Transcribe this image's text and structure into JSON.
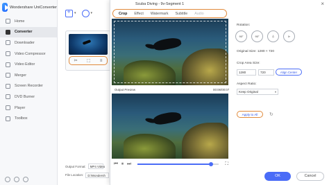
{
  "app": {
    "name": "Wondershare UniConverter"
  },
  "sidebar": {
    "items": [
      {
        "label": "Home",
        "icon": "home-icon"
      },
      {
        "label": "Converter",
        "icon": "converter-icon",
        "active": true
      },
      {
        "label": "Downloader",
        "icon": "download-icon"
      },
      {
        "label": "Video Compressor",
        "icon": "compress-icon"
      },
      {
        "label": "Video Editor",
        "icon": "scissors-icon"
      },
      {
        "label": "Merger",
        "icon": "merge-icon"
      },
      {
        "label": "Screen Recorder",
        "icon": "record-icon"
      },
      {
        "label": "DVD Burner",
        "icon": "disc-icon"
      },
      {
        "label": "Player",
        "icon": "play-icon"
      },
      {
        "label": "Toolbox",
        "icon": "toolbox-icon"
      }
    ]
  },
  "converter": {
    "output_format_label": "Output Format:",
    "output_format_value": "MP4 Video",
    "file_location_label": "File Location:",
    "file_location_value": "D:\\Wondersh"
  },
  "dialog": {
    "title": "Scuba Diving - 9v-Segment 1",
    "tabs": [
      {
        "label": "Crop",
        "active": true
      },
      {
        "label": "Effect"
      },
      {
        "label": "Watermark"
      },
      {
        "label": "Subtitle"
      },
      {
        "label": "Audio",
        "disabled": true
      }
    ],
    "output_preview_label": "Output Preview",
    "timecode": "00:06/00:07",
    "playback_progress": 0.9,
    "rotation_label": "Rotation:",
    "rotate_buttons": [
      "90°",
      "90°"
    ],
    "original_size_label": "Original Size:",
    "original_size_value": "1280 × 720",
    "crop_area_label": "Crop Area Size:",
    "crop_width": "1280",
    "crop_height": "720",
    "multiply_sign": "×",
    "align_center": "Align Center",
    "aspect_ratio_label": "Aspect Ratio:",
    "aspect_ratio_value": "Keep Original",
    "apply_to_all": "Apply to All",
    "ok": "OK",
    "cancel": "Cancel"
  },
  "colors": {
    "accent": "#4a6cf7",
    "highlight": "#e0893a"
  }
}
